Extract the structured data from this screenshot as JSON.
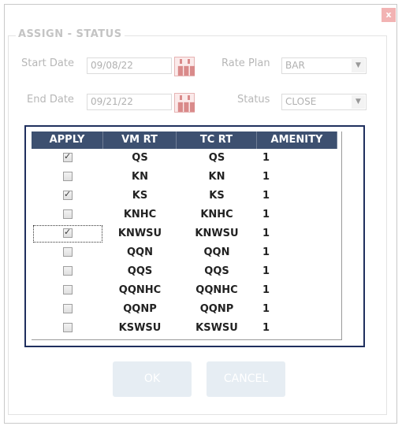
{
  "dialog": {
    "close_glyph": "x"
  },
  "group_title": "ASSIGN - STATUS",
  "form": {
    "start_date_label": "Start Date",
    "start_date_value": "09/08/22",
    "end_date_label": "End Date",
    "end_date_value": "09/21/22",
    "rate_plan_label": "Rate Plan",
    "rate_plan_value": "BAR",
    "status_label": "Status",
    "status_value": "CLOSE",
    "calendar_icon": "calendar-icon"
  },
  "grid": {
    "columns": [
      "APPLY",
      "VM RT",
      "TC RT",
      "AMENITY"
    ],
    "rows": [
      {
        "apply": true,
        "vm_rt": "QS",
        "tc_rt": "QS",
        "amenity": "1"
      },
      {
        "apply": false,
        "vm_rt": "KN",
        "tc_rt": "KN",
        "amenity": "1"
      },
      {
        "apply": true,
        "vm_rt": "KS",
        "tc_rt": "KS",
        "amenity": "1"
      },
      {
        "apply": false,
        "vm_rt": "KNHC",
        "tc_rt": "KNHC",
        "amenity": "1"
      },
      {
        "apply": true,
        "vm_rt": "KNWSU",
        "tc_rt": "KNWSU",
        "amenity": "1"
      },
      {
        "apply": false,
        "vm_rt": "QQN",
        "tc_rt": "QQN",
        "amenity": "1"
      },
      {
        "apply": false,
        "vm_rt": "QQS",
        "tc_rt": "QQS",
        "amenity": "1"
      },
      {
        "apply": false,
        "vm_rt": "QQNHC",
        "tc_rt": "QQNHC",
        "amenity": "1"
      },
      {
        "apply": false,
        "vm_rt": "QQNP",
        "tc_rt": "QQNP",
        "amenity": "1"
      },
      {
        "apply": false,
        "vm_rt": "KSWSU",
        "tc_rt": "KSWSU",
        "amenity": "1"
      }
    ]
  },
  "buttons": {
    "ok_label": "OK",
    "cancel_label": "CANCEL"
  },
  "colors": {
    "header_bg": "#3d5070",
    "frame_border": "#1f2f5e",
    "button_bg": "#e6edf3"
  }
}
